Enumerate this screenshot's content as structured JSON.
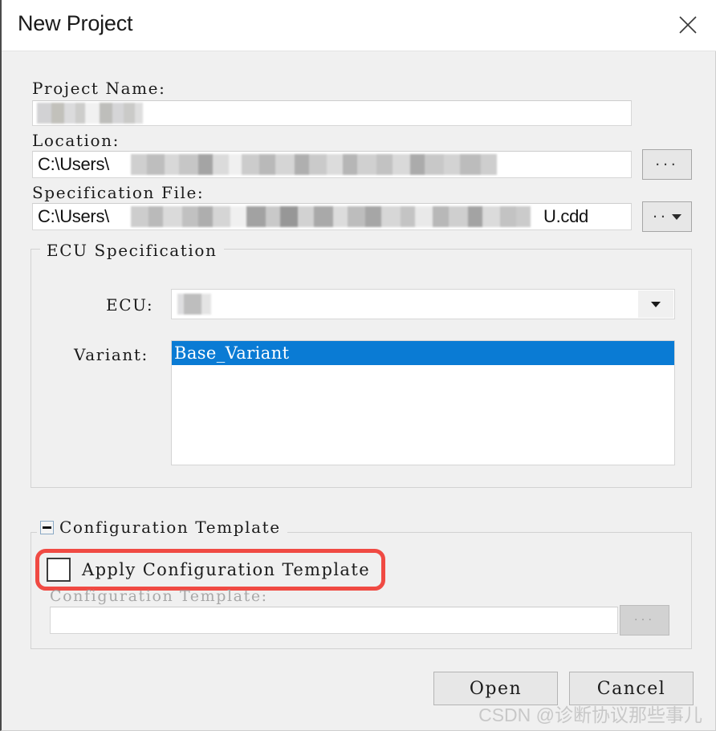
{
  "dialog": {
    "title": "New Project",
    "close_icon": "close-icon"
  },
  "fields": {
    "project_name": {
      "label": "Project Name:",
      "value": "",
      "redacted": true
    },
    "location": {
      "label": "Location:",
      "value": "C:\\Users\\",
      "redacted": true,
      "browse_button": "...",
      "browse_icon": "ellipsis-icon"
    },
    "specification_file": {
      "label": "Specification File:",
      "value_prefix": "C:\\Users\\",
      "value_suffix": "U.cdd",
      "redacted": true,
      "browse_button": "..",
      "browse_icon": "ellipsis-icon",
      "dropdown_icon": "chevron-down-icon"
    }
  },
  "ecu_specification": {
    "group_title": "ECU Specification",
    "ecu": {
      "label": "ECU:",
      "value": "",
      "redacted": true,
      "dropdown_icon": "chevron-down-icon"
    },
    "variant": {
      "label": "Variant:",
      "items": [
        {
          "label": "Base_Variant",
          "selected": true
        }
      ]
    }
  },
  "configuration_template": {
    "group_title": "Configuration Template",
    "collapse_icon": "minus-box-icon",
    "apply_checkbox": {
      "label": "Apply Configuration Template",
      "checked": false
    },
    "template_field": {
      "label": "Configuration Template:",
      "value": "",
      "disabled": true,
      "browse_button": "...",
      "browse_icon": "ellipsis-icon"
    },
    "annotation_color": "#f04a43"
  },
  "footer": {
    "open_label": "Open",
    "cancel_label": "Cancel"
  },
  "watermark": "CSDN @诊断协议那些事儿",
  "colors": {
    "selection_blue": "#0a7bd4",
    "annotation_red": "#f04a43",
    "dialog_bg": "#f0f0f0"
  }
}
